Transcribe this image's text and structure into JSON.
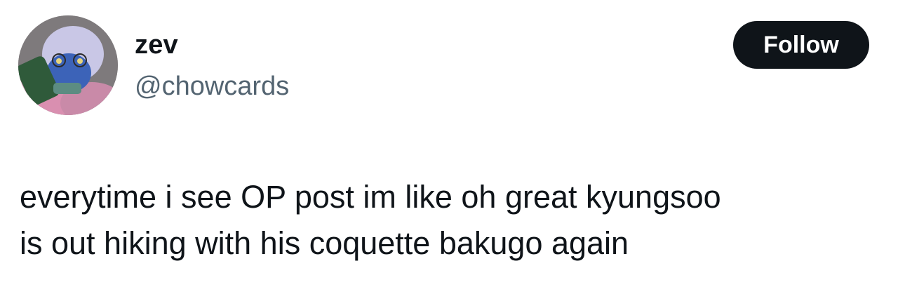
{
  "author": {
    "display_name": "zev",
    "handle": "@chowcards",
    "avatar_icon": "user-avatar-image"
  },
  "follow_button": {
    "label": "Follow",
    "background": "#0f1419",
    "text_color": "#ffffff"
  },
  "tweet": {
    "lines": [
      "everytime i see OP post im like oh great kyungsoo",
      "is out hiking with his coquette bakugo again"
    ]
  },
  "colors": {
    "text_primary": "#0f1419",
    "text_secondary": "#536471",
    "background": "#ffffff"
  }
}
